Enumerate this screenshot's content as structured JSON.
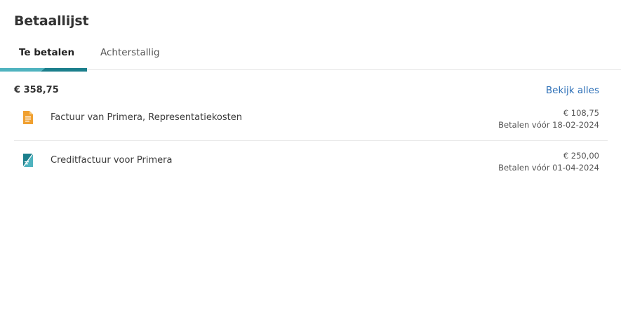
{
  "header": {
    "title": "Betaallijst"
  },
  "tabs": [
    {
      "label": "Te betalen",
      "active": true
    },
    {
      "label": "Achterstallig",
      "active": false
    }
  ],
  "summary": {
    "total": "€ 358,75",
    "view_all_label": "Bekijk alles"
  },
  "items": [
    {
      "icon": "invoice-document-icon",
      "name": "Factuur van Primera, Representatiekosten",
      "amount": "€ 108,75",
      "due": "Betalen vóór 18-02-2024"
    },
    {
      "icon": "credit-invoice-icon",
      "name": "Creditfactuur voor Primera",
      "amount": "€ 250,00",
      "due": "Betalen vóór 01-04-2024"
    }
  ],
  "colors": {
    "accent_teal": "#1b7f8c",
    "accent_light_teal": "#4fb3bf",
    "link_blue": "#2c6fb7",
    "invoice_orange": "#f0a030"
  }
}
